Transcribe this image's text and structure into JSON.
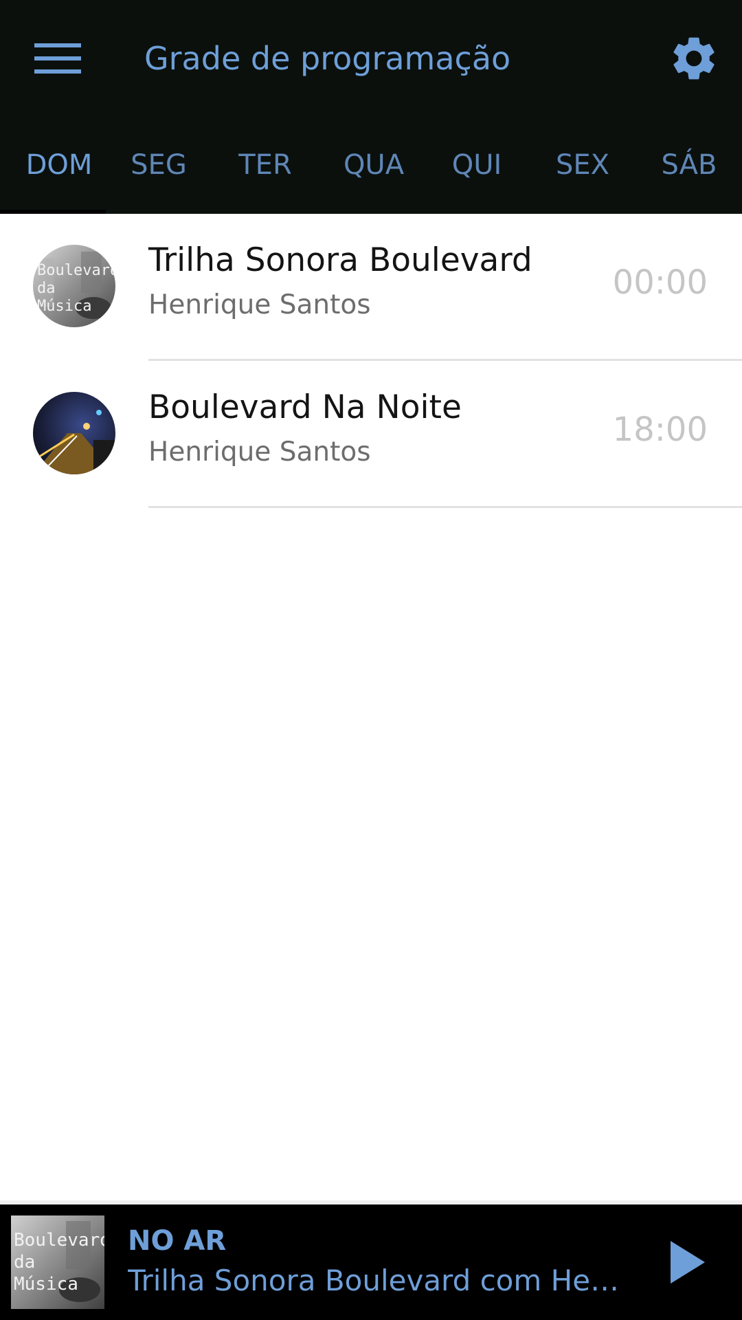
{
  "header": {
    "title": "Grade de programação",
    "menu_icon": "hamburger-menu-icon",
    "settings_icon": "gear-icon",
    "accent_color": "#6e9fd8",
    "background_color": "#0b100d"
  },
  "tabs": [
    {
      "label": "DOM",
      "active": true
    },
    {
      "label": "SEG",
      "active": false
    },
    {
      "label": "TER",
      "active": false
    },
    {
      "label": "QUA",
      "active": false
    },
    {
      "label": "QUI",
      "active": false
    },
    {
      "label": "SEX",
      "active": false
    },
    {
      "label": "SÁB",
      "active": false
    }
  ],
  "schedule": [
    {
      "title": "Trilha Sonora Boulevard",
      "host": "Henrique Santos",
      "time": "00:00",
      "cover": "boulevard-da-musica-cover",
      "cover_text": [
        "Boulevard",
        "da",
        "Música"
      ]
    },
    {
      "title": "Boulevard Na Noite",
      "host": "Henrique Santos",
      "time": "18:00",
      "cover": "night-street-photo"
    }
  ],
  "player": {
    "status": "NO AR",
    "now_playing": "Trilha Sonora Boulevard com Henri...",
    "cover_text": [
      "Boulevard",
      "da",
      "Música"
    ],
    "play_icon": "play-icon"
  }
}
